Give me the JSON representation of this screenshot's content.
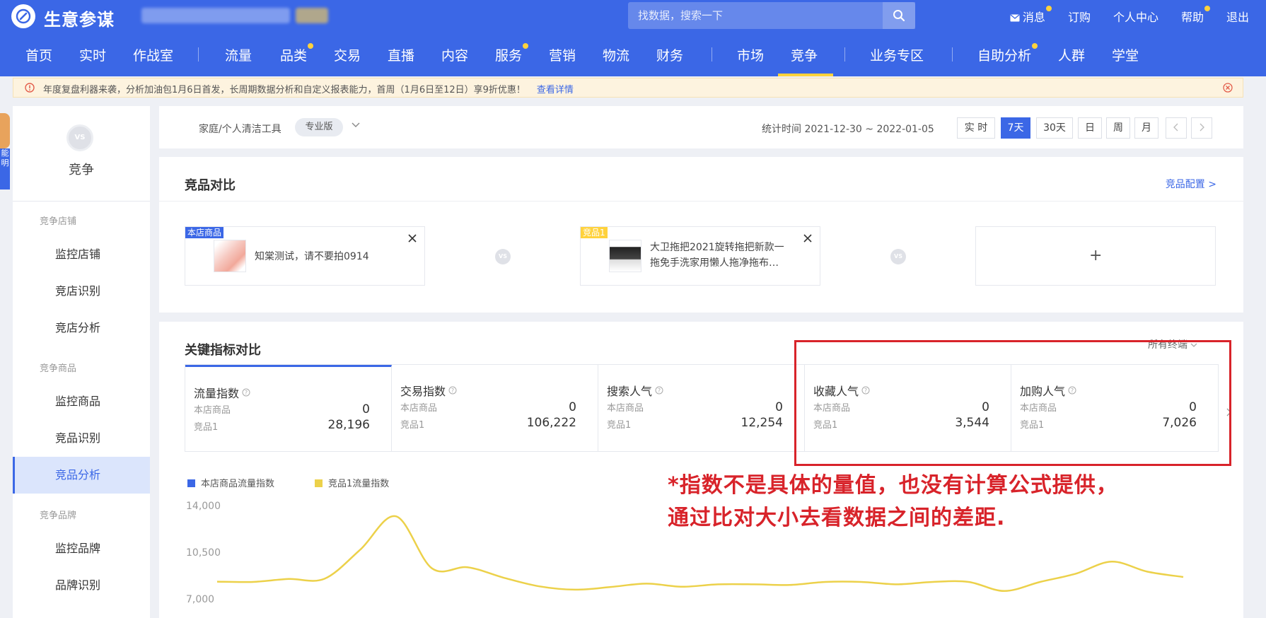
{
  "header": {
    "brand": "生意参谋",
    "search_placeholder": "找数据，搜索一下",
    "links": [
      {
        "label": "消息",
        "dot": true
      },
      {
        "label": "订购",
        "dot": false
      },
      {
        "label": "个人中心",
        "dot": false
      },
      {
        "label": "帮助",
        "dot": true
      },
      {
        "label": "退出",
        "dot": false
      }
    ]
  },
  "nav": {
    "items": [
      {
        "label": "首页",
        "dot": false
      },
      {
        "label": "实时",
        "dot": false
      },
      {
        "label": "作战室",
        "dot": false
      },
      {
        "label": "流量",
        "dot": false
      },
      {
        "label": "品类",
        "dot": true
      },
      {
        "label": "交易",
        "dot": false
      },
      {
        "label": "直播",
        "dot": false
      },
      {
        "label": "内容",
        "dot": false
      },
      {
        "label": "服务",
        "dot": true
      },
      {
        "label": "营销",
        "dot": false
      },
      {
        "label": "物流",
        "dot": false
      },
      {
        "label": "财务",
        "dot": false
      },
      {
        "label": "市场",
        "dot": false
      },
      {
        "label": "竞争",
        "dot": false
      },
      {
        "label": "业务专区",
        "dot": false
      },
      {
        "label": "自助分析",
        "dot": true
      },
      {
        "label": "人群",
        "dot": false
      },
      {
        "label": "学堂",
        "dot": false
      }
    ],
    "active": "竞争"
  },
  "notice": {
    "text": "年度复盘利器来袭，分析加油包1月6日首发，长周期数据分析和自定义报表能力，首周（1月6日至12日）享9折优惠！",
    "link": "查看详情"
  },
  "sidebar": {
    "vs_badge": "VS",
    "title": "竞争",
    "groups": [
      {
        "label": "竞争店铺",
        "items": [
          "监控店铺",
          "竞店识别",
          "竞店分析"
        ]
      },
      {
        "label": "竞争商品",
        "items": [
          "监控商品",
          "竞品识别",
          "竞品分析"
        ]
      },
      {
        "label": "竞争品牌",
        "items": [
          "监控品牌",
          "品牌识别"
        ]
      }
    ],
    "active_item": "竞品分析"
  },
  "filter": {
    "category": "家庭/个人清洁工具",
    "edition": "专业版",
    "stat_time": "统计时间 2021-12-30 ~ 2022-01-05",
    "ranges": [
      "实 时",
      "7天",
      "30天",
      "日",
      "周",
      "月"
    ],
    "active_range": "7天"
  },
  "compare": {
    "title": "竞品对比",
    "config_link": "竞品配置 >",
    "vs_label": "VS",
    "self_tag": "本店商品",
    "self_name": "知棠测试，请不要拍0914",
    "comp_tag": "竞品1",
    "comp_name_line1": "大卫拖把2021旋转拖把新款一",
    "comp_name_line2": "拖免手洗家用懒人拖净拖布…",
    "add_symbol": "+"
  },
  "metrics": {
    "title": "关键指标对比",
    "terminal": "所有终端",
    "self_label": "本店商品",
    "comp_label": "竞品1",
    "items": [
      {
        "name": "流量指数",
        "self": "0",
        "comp": "28,196"
      },
      {
        "name": "交易指数",
        "self": "0",
        "comp": "106,222"
      },
      {
        "name": "搜索人气",
        "self": "0",
        "comp": "12,254"
      },
      {
        "name": "收藏人气",
        "self": "0",
        "comp": "3,544"
      },
      {
        "name": "加购人气",
        "self": "0",
        "comp": "7,026"
      }
    ]
  },
  "chart_data": {
    "type": "line",
    "legend": [
      "本店商品流量指数",
      "竞品1流量指数"
    ],
    "yticks": [
      "14,000",
      "10,500",
      "7,000"
    ],
    "ylim": [
      7000,
      14000
    ],
    "series": [
      {
        "name": "竞品1流量指数",
        "color": "#ecd14a",
        "values": [
          8400,
          8380,
          8600,
          8620,
          10800,
          13300,
          9400,
          9480,
          8700,
          8050,
          7800,
          8000,
          8250,
          8020,
          8200,
          8200,
          8150,
          8380,
          8380,
          8200,
          8380,
          8380,
          7700,
          8380,
          9000,
          9900,
          9150,
          8750
        ]
      },
      {
        "name": "本店商品流量指数",
        "color": "#3b67e6",
        "values": []
      }
    ]
  },
  "annotation": {
    "line1": "*指数不是具体的量值，也没有计算公式提供，",
    "line2": "通过比对大小去看数据之间的差距."
  },
  "mascot_tag": "能明",
  "colors": {
    "brand": "#3b67e6",
    "accent": "#ffd23c",
    "annotation": "#d8232a"
  }
}
